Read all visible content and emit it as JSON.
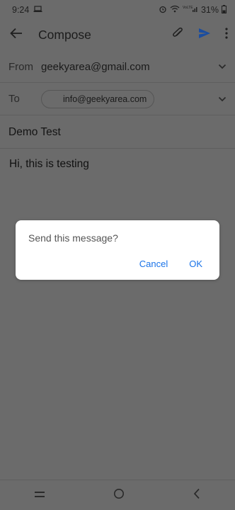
{
  "status_bar": {
    "time": "9:24",
    "battery": "31%",
    "network_label": "VoLTE LTE1"
  },
  "app_bar": {
    "title": "Compose"
  },
  "from_row": {
    "label": "From",
    "value": "geekyarea@gmail.com"
  },
  "to_row": {
    "label": "To",
    "recipient": "info@geekyarea.com"
  },
  "subject": "Demo Test",
  "body": "Hi, this is testing",
  "dialog": {
    "message": "Send this message?",
    "cancel_label": "Cancel",
    "ok_label": "OK"
  },
  "colors": {
    "accent": "#1a73e8",
    "scrim": "#6b6b6b"
  }
}
